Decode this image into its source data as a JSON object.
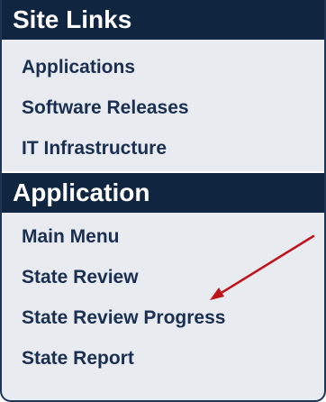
{
  "sections": [
    {
      "title": "Site Links",
      "items": [
        "Applications",
        "Software Releases",
        "IT Infrastructure"
      ]
    },
    {
      "title": "Application",
      "items": [
        "Main Menu",
        "State Review",
        "State Review Progress",
        "State Report"
      ]
    }
  ],
  "annotation": {
    "icon": "red-arrow-icon",
    "color": "#c0141c"
  }
}
